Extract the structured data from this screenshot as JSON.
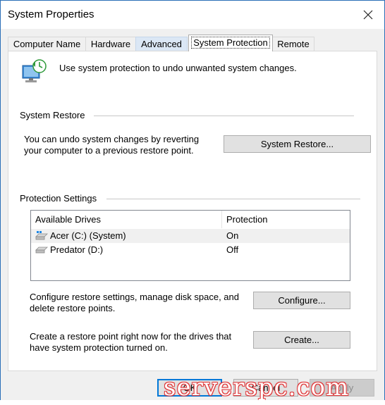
{
  "window": {
    "title": "System Properties"
  },
  "tabs": [
    {
      "label": "Computer Name"
    },
    {
      "label": "Hardware"
    },
    {
      "label": "Advanced"
    },
    {
      "label": "System Protection"
    },
    {
      "label": "Remote"
    }
  ],
  "intro": {
    "text": "Use system protection to undo unwanted system changes."
  },
  "system_restore": {
    "heading": "System Restore",
    "description_line1": "You can undo system changes by reverting",
    "description_line2": "your computer to a previous restore point.",
    "button_label": "System Restore..."
  },
  "protection_settings": {
    "heading": "Protection Settings",
    "columns": [
      "Available Drives",
      "Protection"
    ],
    "drives": [
      {
        "name": "Acer (C:) (System)",
        "protection": "On"
      },
      {
        "name": "Predator (D:)",
        "protection": "Off"
      }
    ],
    "configure_text_line1": "Configure restore settings, manage disk space, and",
    "configure_text_line2": "delete restore points.",
    "configure_button": "Configure...",
    "create_text_line1": "Create a restore point right now for the drives that",
    "create_text_line2": "have system protection turned on.",
    "create_button": "Create..."
  },
  "footer": {
    "ok": "OK",
    "cancel": "Cancel",
    "apply": "Apply"
  },
  "watermark": {
    "text": "serverspc.com"
  },
  "colors": {
    "accent": "#0078d7",
    "watermark": "#e0383a"
  }
}
